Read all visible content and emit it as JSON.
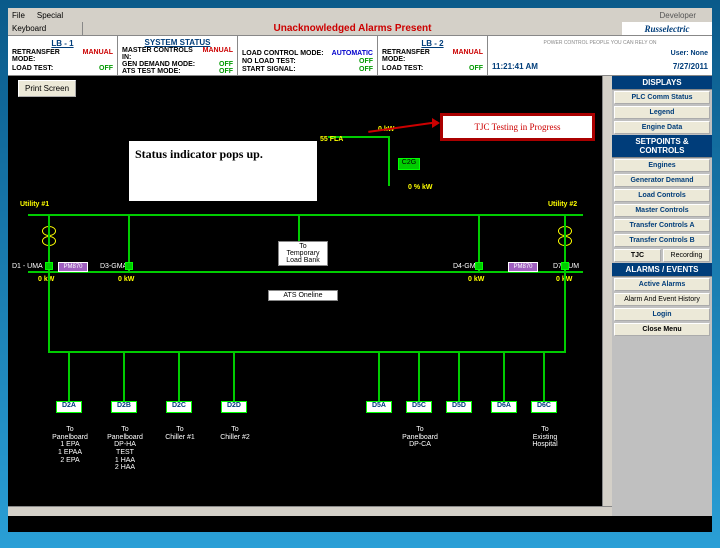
{
  "menubar": {
    "file": "File",
    "special": "Special",
    "developer": "Developer"
  },
  "alarm": {
    "keyboard": "Keyboard",
    "message": "Unacknowledged Alarms Present",
    "logo": "Russelectric"
  },
  "topstatus": {
    "lb1": {
      "header": "LB - 1",
      "retransfer_lbl": "RETRANSFER MODE:",
      "retransfer_val": "MANUAL",
      "loadtest_lbl": "LOAD TEST:",
      "loadtest_val": "OFF"
    },
    "sys": {
      "header": "SYSTEM STATUS",
      "master_lbl": "MASTER CONTROLS IN:",
      "master_val": "MANUAL",
      "gen_lbl": "GEN DEMAND MODE:",
      "gen_val": "OFF",
      "ats_lbl": "ATS TEST MODE:",
      "ats_val": "OFF"
    },
    "mid": {
      "loadctrl_lbl": "LOAD CONTROL MODE:",
      "loadctrl_val": "AUTOMATIC",
      "noload_lbl": "NO LOAD TEST:",
      "noload_val": "OFF",
      "start_lbl": "START SIGNAL:",
      "start_val": "OFF"
    },
    "lb2": {
      "header": "LB - 2",
      "retransfer_lbl": "RETRANSFER MODE:",
      "retransfer_val": "MANUAL",
      "loadtest_lbl": "LOAD TEST:",
      "loadtest_val": "OFF"
    },
    "user": {
      "tagline": "POWER CONTROL PEOPLE YOU CAN RELY ON",
      "user_lbl": "User: None",
      "time": "11:21:41 AM",
      "date": "7/27/2011"
    }
  },
  "print": "Print Screen",
  "popup1": "Status indicator pops up.",
  "popup2": "TJC Testing in Progress",
  "sidebar": {
    "displays_hdr": "DISPLAYS",
    "plc": "PLC Comm Status",
    "legend": "Legend",
    "engine": "Engine Data",
    "setpoints_hdr": "SETPOINTS & CONTROLS",
    "engines": "Engines",
    "gendemand": "Generator Demand",
    "loadctrl": "Load Controls",
    "masterctrl": "Master Controls",
    "transferA": "Transfer Controls A",
    "transferB": "Transfer Controls B",
    "tjc": "TJC",
    "recording": "Recording",
    "alarms_hdr": "ALARMS / EVENTS",
    "active": "Active Alarms",
    "history": "Alarm And Event History",
    "login": "Login",
    "close": "Close Menu"
  },
  "diagram": {
    "kw": "0 kW",
    "kwpct": "0 % kW",
    "fla": "55 FLA",
    "c2g": "C2G",
    "util1": "Utility #1",
    "util2": "Utility #2",
    "d1": "D1 - UMA",
    "d3": "D3-GMA",
    "d4": "D4-GMB",
    "d7": "D7 - UM",
    "pm": "PM870",
    "tolb": "To\nTemporary\nLoad Bank",
    "ats": "ATS Oneline",
    "d2a": "D2A",
    "d2b": "D2B",
    "d2c": "D2C",
    "d2d": "D2D",
    "d5a": "D5A",
    "d5c": "D5C",
    "d5d": "D5D",
    "d6a": "D6A",
    "d6c": "D6C",
    "pb1": "To\nPanelboard\n1 EPA\n1 EPAA\n2 EPA",
    "pb2": "To\nPanelboard\nDP-HA\nTEST\n1 HAA\n2 HAA",
    "pb3": "To\nChiller #1",
    "pb4": "To\nChiller #2",
    "pb5": "To\nPanelboard\nDP-CA",
    "pb6": "To\nExisting\nHospital"
  }
}
